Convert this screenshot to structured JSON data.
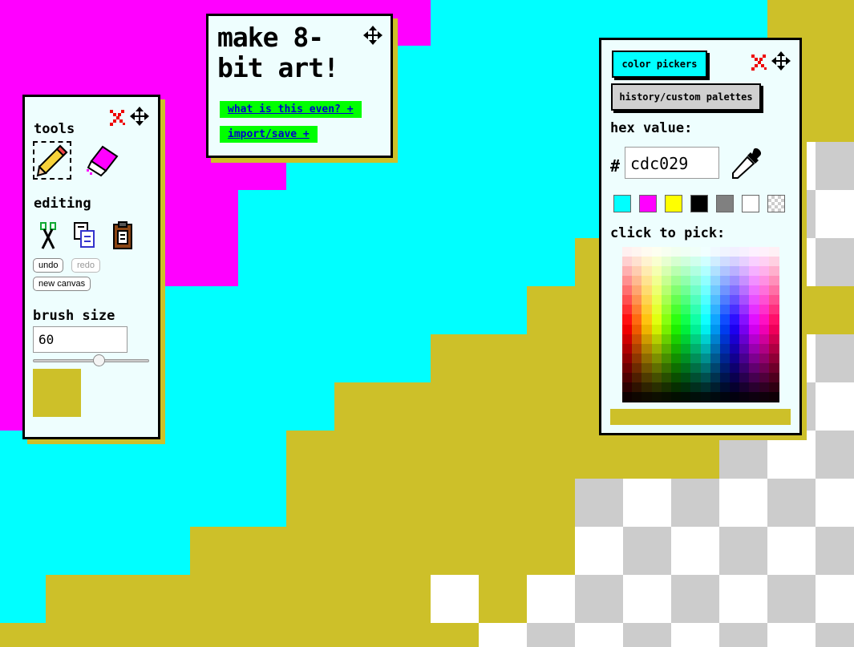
{
  "canvas": {
    "colors": {
      "magenta": "#ff00ff",
      "cyan": "#00ffff",
      "gold": "#cdc029",
      "checker_light": "#ffffff",
      "checker_dark": "#cccccc"
    }
  },
  "tools_panel": {
    "tools_label": "tools",
    "editing_label": "editing",
    "undo_label": "undo",
    "redo_label": "redo",
    "new_canvas_label": "new canvas",
    "brush_size_label": "brush size",
    "brush_size_value": "60",
    "brush_slider_fraction": 0.58,
    "current_color": "#cdc029",
    "icons": [
      "close-icon",
      "move-icon",
      "pencil-icon",
      "eraser-icon",
      "scissors-icon",
      "copy-icon",
      "paste-icon"
    ]
  },
  "title_panel": {
    "title": "make 8-bit art!",
    "links": [
      "what is this even? +",
      "import/save +"
    ],
    "icons": [
      "move-icon"
    ]
  },
  "color_panel": {
    "tab_color_pickers": "color pickers",
    "tab_history": "history/custom palettes",
    "hex_label": "hex value:",
    "hash": "#",
    "hex_value": "cdc029",
    "click_to_pick_label": "click to pick:",
    "current_color": "#cdc029",
    "swatches": [
      "#00ffff",
      "#ff00ff",
      "#ffff00",
      "#000000",
      "#808080",
      "#ffffff",
      "transparent"
    ],
    "icons": [
      "close-icon",
      "move-icon",
      "eyedropper-icon"
    ]
  }
}
